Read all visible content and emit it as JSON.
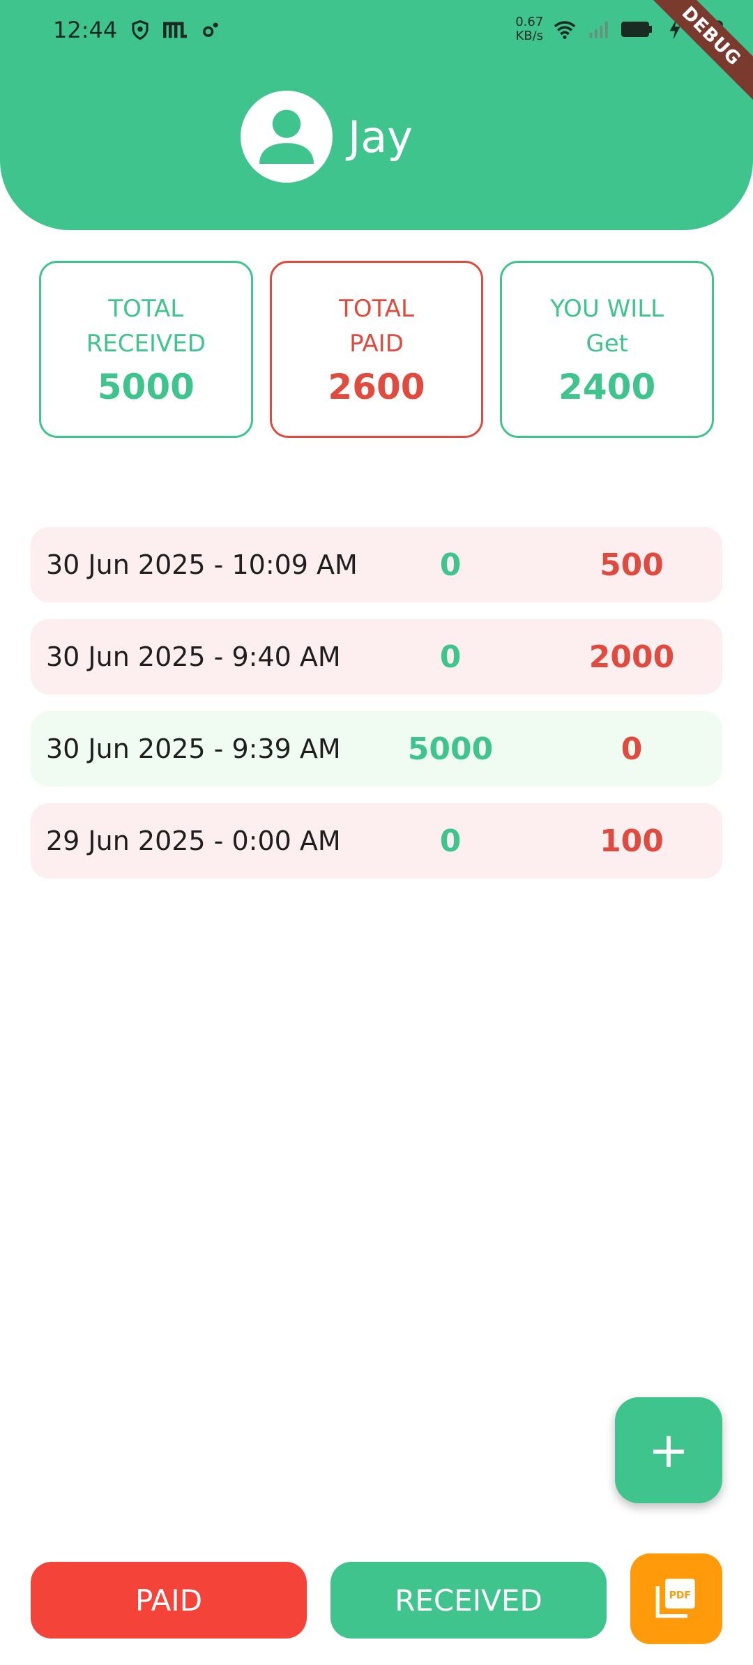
{
  "status_bar": {
    "time": "12:44",
    "net_speed_value": "0.67",
    "net_speed_unit": "KB/s",
    "battery_text": "83",
    "debug_label": "DEBUG"
  },
  "profile": {
    "name": "Jay",
    "avatar_icon": "person-icon"
  },
  "summary": {
    "received": {
      "label_line1": "TOTAL",
      "label_line2": "RECEIVED",
      "value": "5000"
    },
    "paid": {
      "label_line1": "TOTAL",
      "label_line2": "PAID",
      "value": "2600"
    },
    "will_get": {
      "label_line1": "YOU WILL",
      "label_line2": "Get",
      "value": "2400"
    }
  },
  "transactions": [
    {
      "date": "30 Jun 2025 - 10:09 AM",
      "received": "0",
      "paid": "500",
      "type": "paid"
    },
    {
      "date": "30 Jun 2025 - 9:40 AM",
      "received": "0",
      "paid": "2000",
      "type": "paid"
    },
    {
      "date": "30 Jun 2025 - 9:39 AM",
      "received": "5000",
      "paid": "0",
      "type": "received"
    },
    {
      "date": "29 Jun 2025 - 0:00 AM",
      "received": "0",
      "paid": "100",
      "type": "paid"
    }
  ],
  "fab": {
    "symbol": "+",
    "icon": "plus-icon"
  },
  "buttons": {
    "paid_label": "PAID",
    "received_label": "RECEIVED",
    "pdf_icon": "pdf-icon"
  },
  "colors": {
    "primary_green": "#40C48E",
    "paid_red": "#E04B3F",
    "pdf_orange": "#FF9A0A"
  }
}
